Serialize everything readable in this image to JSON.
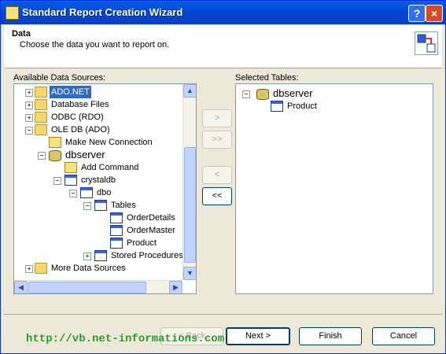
{
  "window": {
    "title": "Standard Report Creation Wizard",
    "help_label": "?",
    "close_label": "×"
  },
  "header": {
    "title": "Data",
    "subtitle": "Choose the data you want to report on."
  },
  "available": {
    "label": "Available Data Sources:",
    "tree": [
      {
        "label": "ADO.NET",
        "expander": "+",
        "selected": true
      },
      {
        "label": "Database Files",
        "expander": "+"
      },
      {
        "label": "ODBC (RDO)",
        "expander": "+"
      },
      {
        "label": "OLE DB (ADO)",
        "expander": "−"
      },
      {
        "label": "Make New Connection"
      },
      {
        "label": "dbserver",
        "expander": "−"
      },
      {
        "label": "Add Command"
      },
      {
        "label": "crystaldb",
        "expander": "−"
      },
      {
        "label": "dbo",
        "expander": "−"
      },
      {
        "label": "Tables",
        "expander": "−"
      },
      {
        "label": "OrderDetails"
      },
      {
        "label": "OrderMaster"
      },
      {
        "label": "Product"
      },
      {
        "label": "Stored Procedures",
        "expander": "+"
      },
      {
        "label": "More Data Sources",
        "expander": "+"
      }
    ]
  },
  "selected": {
    "label": "Selected Tables:",
    "tree": [
      {
        "label": "dbserver",
        "expander": "−"
      },
      {
        "label": "Product"
      }
    ]
  },
  "transfer": {
    "add_one": ">",
    "add_all": ">>",
    "remove_one": "<",
    "remove_all": "<<"
  },
  "footer": {
    "back_label": "< Back",
    "next_label": "Next >",
    "finish_label": "Finish",
    "cancel_label": "Cancel"
  },
  "watermark": "http://vb.net-informations.com"
}
